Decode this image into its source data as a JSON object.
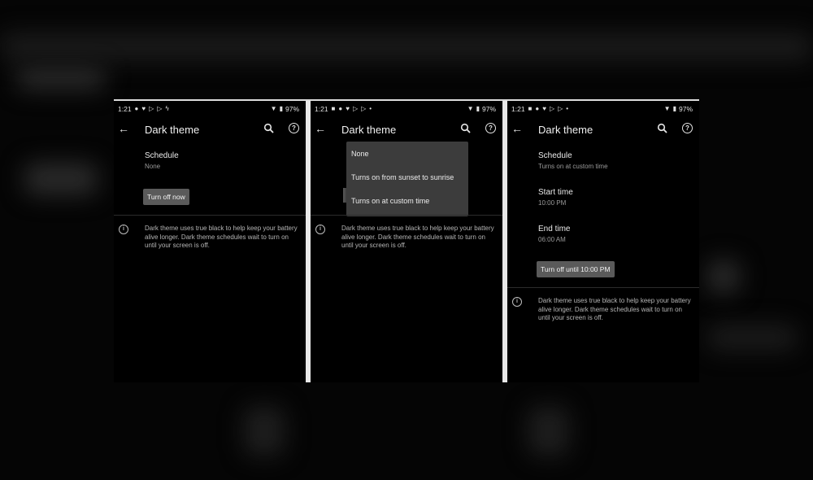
{
  "status": {
    "time": "1:21",
    "battery": "97%"
  },
  "colors": {
    "background": "#000000",
    "menu": "#3c3c3c",
    "button": "#5a5a5a",
    "text": "#e6e6e6",
    "subtext": "#9a9a9a"
  },
  "icons": {
    "back": "arrow-left-icon",
    "search": "search-icon",
    "help": "help-icon",
    "info": "info-icon",
    "wifi": "wifi-icon",
    "battery": "battery-icon"
  },
  "page": {
    "title": "Dark theme"
  },
  "info_text": "Dark theme uses true black to help keep your battery alive longer. Dark theme schedules wait to turn on until your screen is off.",
  "screen1": {
    "schedule_title": "Schedule",
    "schedule_value": "None",
    "button_label": "Turn off now"
  },
  "screen2": {
    "menu": [
      "None",
      "Turns on from sunset to sunrise",
      "Turns on at custom time"
    ]
  },
  "screen3": {
    "schedule_title": "Schedule",
    "schedule_value": "Turns on at custom time",
    "start_title": "Start time",
    "start_value": "10:00 PM",
    "end_title": "End time",
    "end_value": "06:00 AM",
    "button_label": "Turn off until 10:00 PM"
  }
}
